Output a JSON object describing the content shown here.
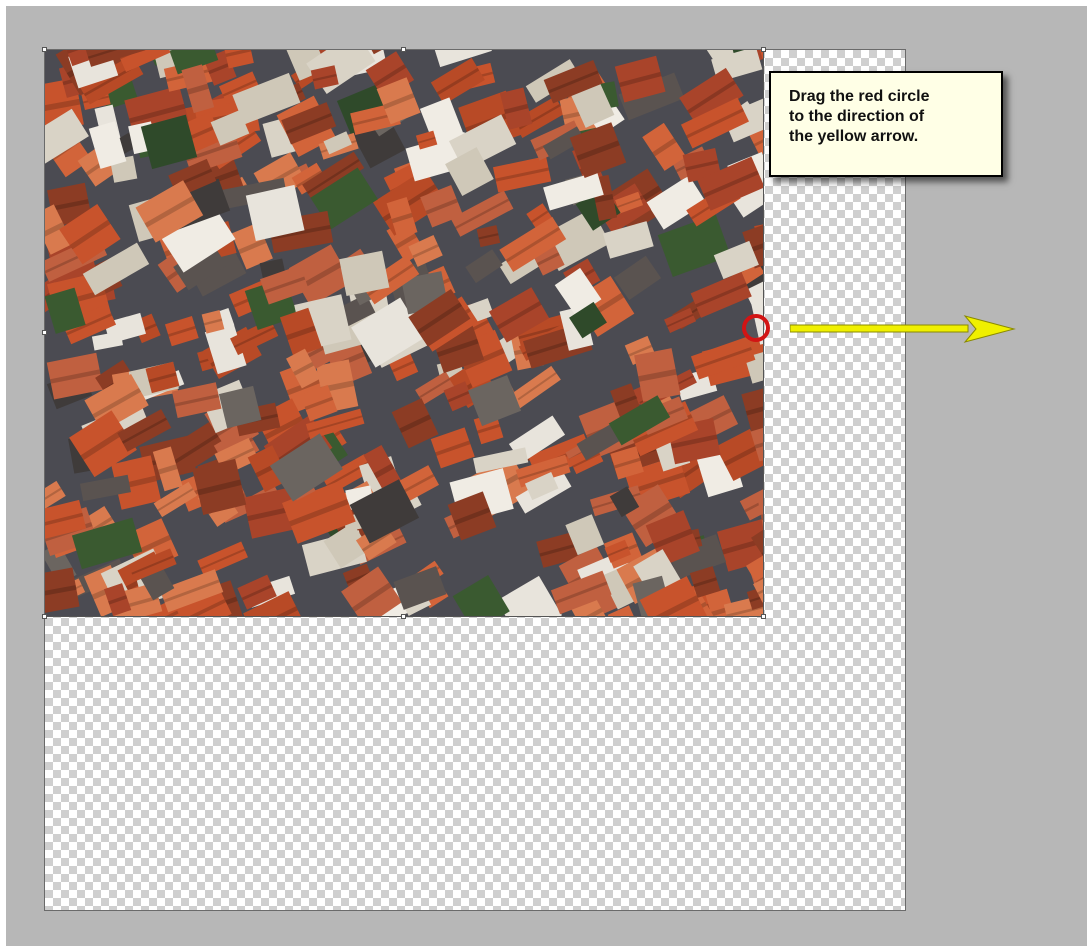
{
  "tooltip": {
    "lines": [
      "Drag the red circle",
      "to the direction of",
      "the yellow arrow."
    ]
  },
  "canvas": {
    "background": "transparent-checkerboard",
    "image_content": "aerial photo of old town rooftops"
  },
  "colors": {
    "workspace": "#b7b7b7",
    "circle": "#d21414",
    "arrow": "#f0f000",
    "callout_bg": "#ffffe6"
  },
  "icons": {
    "drag_target": "red-circle-icon",
    "direction": "yellow-arrow-icon"
  }
}
